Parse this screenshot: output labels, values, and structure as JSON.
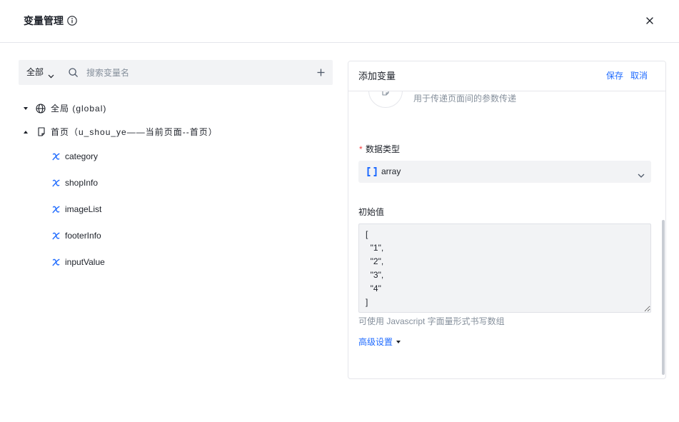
{
  "dialog": {
    "title": "变量管理",
    "info_icon": "info-circle-icon",
    "close_icon": "close-icon"
  },
  "toolbar": {
    "scope_selected": "全部",
    "scope_icon": "chevron-down-icon",
    "search_icon": "search-icon",
    "search_placeholder": "搜索变量名",
    "search_value": "",
    "add_icon": "plus-icon"
  },
  "tree": {
    "global": {
      "label": "全局 (global)",
      "icon": "globe-icon",
      "toggle_icon": "caret-down-icon"
    },
    "page": {
      "label": "首页（u_shou_ye——当前页面--首页）",
      "icon": "page-icon",
      "toggle_icon": "caret-up-icon",
      "variable_icon": "variable-x-icon",
      "variables": [
        "category",
        "shopInfo",
        "imageList",
        "footerInfo",
        "inputValue"
      ]
    }
  },
  "editor": {
    "title": "添加变量",
    "save_label": "保存",
    "cancel_label": "取消",
    "variable_type": {
      "icon": "page-icon",
      "description": "用于传递页面间的参数传递"
    },
    "data_type": {
      "required_mark": "*",
      "label": "数据类型",
      "selected_value": "array",
      "value_icon": "array-bracket-icon",
      "dropdown_icon": "chevron-down-icon"
    },
    "initial_value": {
      "label": "初始值",
      "value": "[\n  \"1\",\n  \"2\",\n  \"3\",\n  \"4\"\n]",
      "help_text": "可使用 Javascript 字面量形式书写数组"
    },
    "advanced": {
      "label": "高级设置",
      "icon": "caret-down-icon"
    }
  },
  "colors": {
    "accent": "#1f6bff",
    "required": "#f53f3f",
    "text_primary": "#1d2129",
    "text_secondary": "#86909c",
    "field_background": "#f2f3f5",
    "border": "#e5e6eb"
  }
}
